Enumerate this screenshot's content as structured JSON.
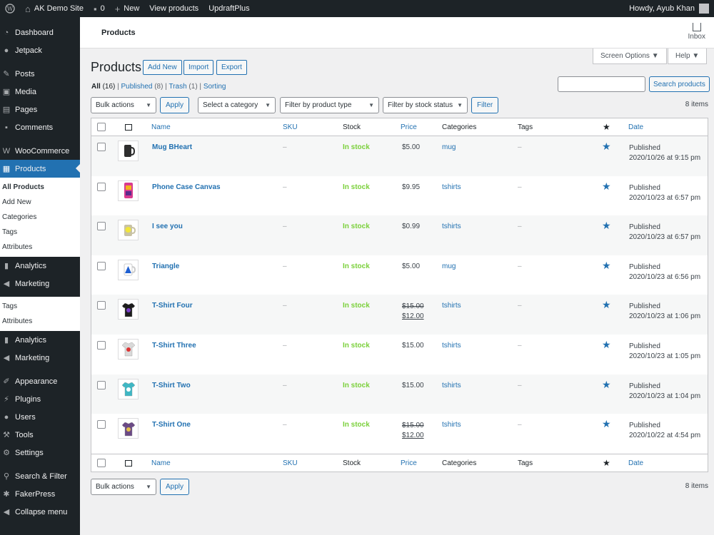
{
  "adminbar": {
    "site": "AK Demo Site",
    "comments": "0",
    "new": "New",
    "view": "View products",
    "updraft": "UpdraftPlus",
    "howdy": "Howdy, Ayub Khan"
  },
  "sidebar": {
    "top_items": [
      "Dashboard",
      "Jetpack",
      "Posts",
      "Media",
      "Pages",
      "Comments",
      "WooCommerce",
      "Products"
    ],
    "products_sub": [
      "All Products",
      "Add New",
      "Categories",
      "Tags",
      "Attributes"
    ],
    "mid_items": [
      "Analytics",
      "Marketing"
    ],
    "ghost_sub": [
      "Tags",
      "Attributes"
    ],
    "mid2_items": [
      "Analytics",
      "Marketing"
    ],
    "bottom_items": [
      "Appearance",
      "Plugins",
      "Users",
      "Tools",
      "Settings",
      "Search & Filter",
      "FakerPress",
      "Collapse menu"
    ]
  },
  "topbar": {
    "crumb": "Products",
    "inbox": "Inbox"
  },
  "tabs": {
    "screen_options": "Screen Options ▼",
    "help": "Help ▼"
  },
  "page": {
    "title": "Products",
    "add_new": "Add New",
    "import": "Import",
    "export": "Export"
  },
  "views": {
    "all": "All",
    "all_count": "(16)",
    "published": "Published",
    "published_count": "(8)",
    "trash": "Trash",
    "trash_count": "(1)",
    "sorting": "Sorting"
  },
  "search": {
    "button": "Search products",
    "placeholder": ""
  },
  "filters": {
    "bulk": "Bulk actions",
    "apply": "Apply",
    "category": "Select a category",
    "type": "Filter by product type",
    "stock": "Filter by stock status",
    "filter": "Filter",
    "items": "8 items"
  },
  "table": {
    "headers": {
      "name": "Name",
      "sku": "SKU",
      "stock": "Stock",
      "price": "Price",
      "categories": "Categories",
      "tags": "Tags",
      "date": "Date"
    },
    "rows": [
      {
        "name": "Mug BHeart",
        "sku": "–",
        "stock": "In stock",
        "price": "$5.00",
        "sale": "",
        "cat": "mug",
        "tags": "–",
        "status": "Published",
        "date": "2020/10/26 at 9:15 pm"
      },
      {
        "name": "Phone Case Canvas",
        "sku": "–",
        "stock": "In stock",
        "price": "$9.95",
        "sale": "",
        "cat": "tshirts",
        "tags": "–",
        "status": "Published",
        "date": "2020/10/23 at 6:57 pm"
      },
      {
        "name": "I see you",
        "sku": "–",
        "stock": "In stock",
        "price": "$0.99",
        "sale": "",
        "cat": "tshirts",
        "tags": "–",
        "status": "Published",
        "date": "2020/10/23 at 6:57 pm"
      },
      {
        "name": "Triangle",
        "sku": "–",
        "stock": "In stock",
        "price": "$5.00",
        "sale": "",
        "cat": "mug",
        "tags": "–",
        "status": "Published",
        "date": "2020/10/23 at 6:56 pm"
      },
      {
        "name": "T-Shirt Four",
        "sku": "–",
        "stock": "In stock",
        "price": "$15.00",
        "sale": "$12.00",
        "cat": "tshirts",
        "tags": "–",
        "status": "Published",
        "date": "2020/10/23 at 1:06 pm"
      },
      {
        "name": "T-Shirt Three",
        "sku": "–",
        "stock": "In stock",
        "price": "$15.00",
        "sale": "",
        "cat": "tshirts",
        "tags": "–",
        "status": "Published",
        "date": "2020/10/23 at 1:05 pm"
      },
      {
        "name": "T-Shirt Two",
        "sku": "–",
        "stock": "In stock",
        "price": "$15.00",
        "sale": "",
        "cat": "tshirts",
        "tags": "–",
        "status": "Published",
        "date": "2020/10/23 at 1:04 pm"
      },
      {
        "name": "T-Shirt One",
        "sku": "–",
        "stock": "In stock",
        "price": "$15.00",
        "sale": "$12.00",
        "cat": "tshirts",
        "tags": "–",
        "status": "Published",
        "date": "2020/10/22 at 4:54 pm"
      }
    ]
  },
  "bottom": {
    "bulk": "Bulk actions",
    "apply": "Apply",
    "items": "8 items"
  }
}
